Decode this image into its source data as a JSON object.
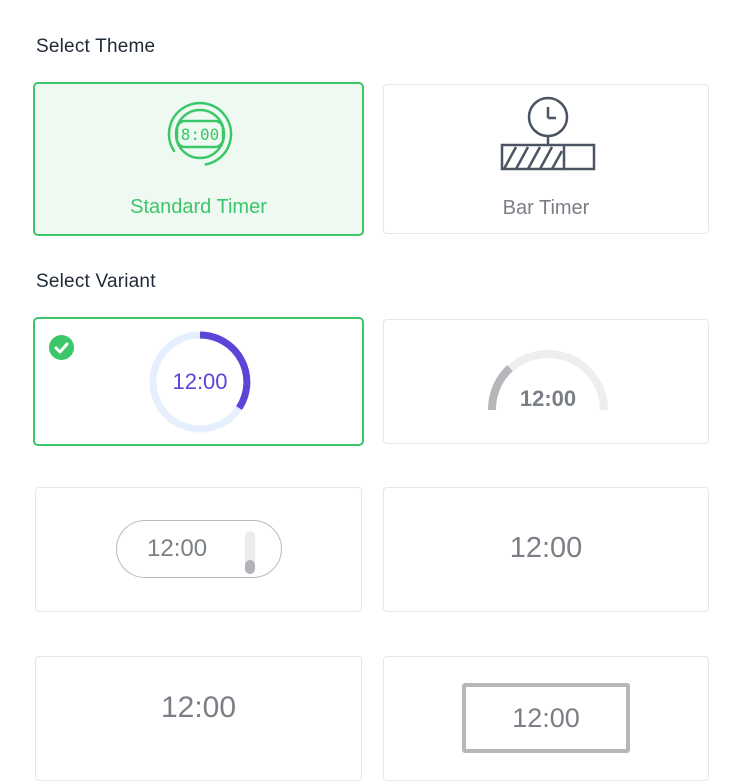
{
  "theme_section": {
    "heading": "Select Theme",
    "options": [
      {
        "label": "Standard Timer",
        "icon_text": "8:00",
        "icon": "standard-timer-icon",
        "selected": true
      },
      {
        "label": "Bar Timer",
        "icon": "bar-timer-icon",
        "selected": false
      }
    ]
  },
  "variant_section": {
    "heading": "Select Variant",
    "variants": [
      {
        "time": "12:00",
        "style": "circular-ring",
        "selected": true,
        "progress": 0.35
      },
      {
        "time": "12:00",
        "style": "semicircle-gauge",
        "selected": false,
        "progress": 0.2
      },
      {
        "time": "12:00",
        "style": "pill-with-slider",
        "selected": false
      },
      {
        "time": "12:00",
        "style": "plain-text",
        "selected": false
      },
      {
        "time": "12:00",
        "style": "plain-text-large",
        "selected": false
      },
      {
        "time": "12:00",
        "style": "boxed",
        "selected": false
      }
    ]
  },
  "colors": {
    "accent": "#3cc66a",
    "ring_progress": "#5b45d6",
    "ring_track": "#e6effd",
    "muted": "#7a7f86"
  }
}
